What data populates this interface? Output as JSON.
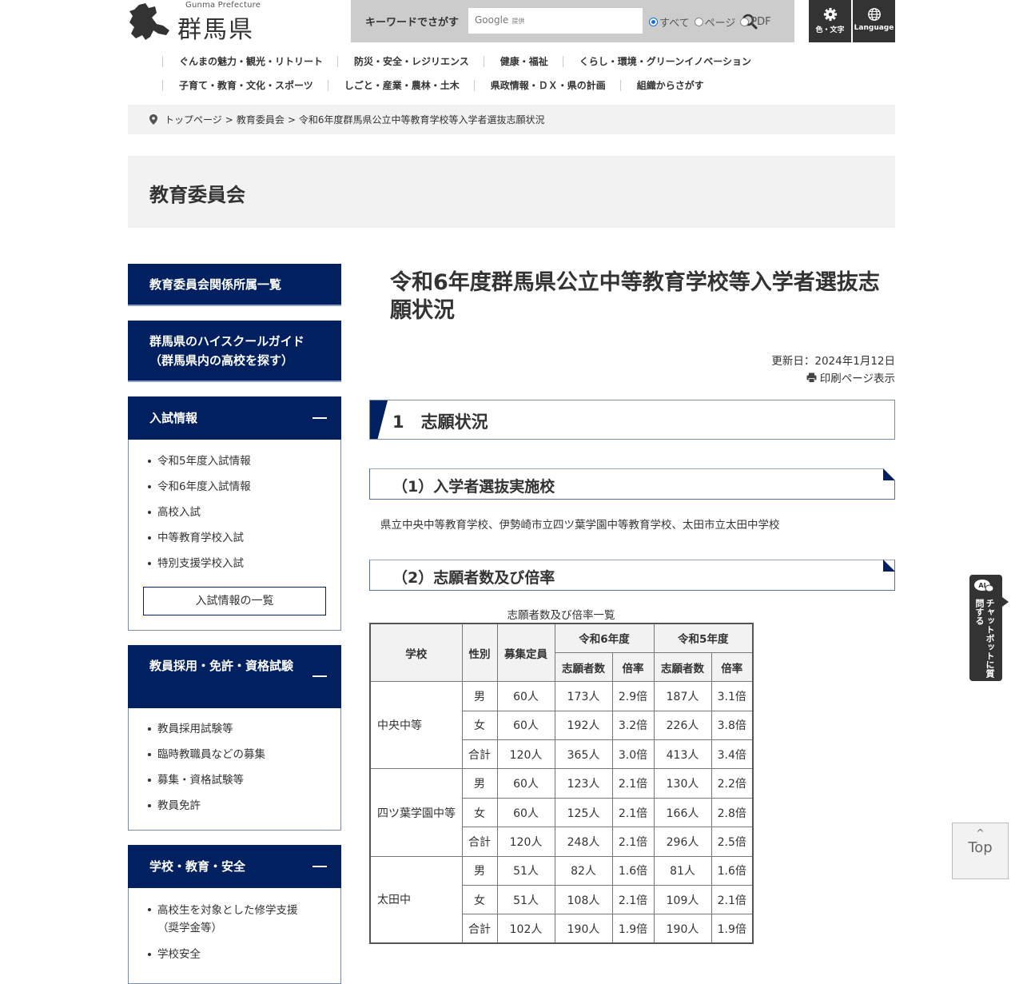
{
  "header": {
    "logo_en": "Gunma Prefecture",
    "logo_jp": "群馬県",
    "search": {
      "label": "キーワードでさがす",
      "placeholder": "Google",
      "placeholder_sub": "提供",
      "options": [
        {
          "label": "すべて",
          "selected": true
        },
        {
          "label": "ページ",
          "selected": false
        },
        {
          "label": "PDF",
          "selected": false
        }
      ]
    },
    "tools": [
      {
        "icon": "gear-icon",
        "label": "色・文字"
      },
      {
        "icon": "globe-icon",
        "label": "Language"
      }
    ]
  },
  "gnav": {
    "row1": [
      "ぐんまの魅力・観光・リトリート",
      "防災・安全・レジリエンス",
      "健康・福祉",
      "くらし・環境・グリーンイノベーション"
    ],
    "row2": [
      "子育て・教育・文化・スポーツ",
      "しごと・産業・農林・土木",
      "県政情報・ＤＸ・県の計画",
      "組織からさがす"
    ]
  },
  "breadcrumb": {
    "items": [
      "トップページ",
      "教育委員会",
      "令和6年度群馬県公立中等教育学校等入学者選抜志願状況"
    ],
    "separator": ">"
  },
  "department": "教育委員会",
  "sidebar": {
    "buttons": [
      "教育委員会関係所属一覧",
      "群馬県のハイスクールガイド（群馬県内の高校を探す）"
    ],
    "sections": [
      {
        "title": "入試情報",
        "items": [
          "令和5年度入試情報",
          "令和6年度入試情報",
          "高校入試",
          "中等教育学校入試",
          "特別支援学校入試"
        ],
        "more": "入試情報の一覧"
      },
      {
        "title": "教員採用・免許・資格試験",
        "items": [
          "教員採用試験等",
          "臨時教職員などの募集",
          "募集・資格試験等",
          "教員免許"
        ]
      },
      {
        "title": "学校・教育・安全",
        "items": [
          "高校生を対象とした修学支援（奨学金等）",
          "学校安全"
        ]
      }
    ]
  },
  "main": {
    "title": "令和6年度群馬県公立中等教育学校等入学者選抜志願状況",
    "updated": "更新日：2024年1月12日",
    "print": "印刷ページ表示",
    "h2": "1　志願状況",
    "h3_1": "（1）入学者選抜実施校",
    "schools_text": "県立中央中等教育学校、伊勢崎市立四ツ葉学園中等教育学校、太田市立太田中学校",
    "h3_2": "（2）志願者数及び倍率",
    "table": {
      "caption": "志願者数及び倍率一覧",
      "headers": {
        "school": "学校",
        "gender": "性別",
        "capacity": "募集定員",
        "r6": "令和6年度",
        "r5": "令和5年度",
        "applicants": "志願者数",
        "ratio": "倍率"
      },
      "groups": [
        {
          "school": "中央中等",
          "rows": [
            {
              "gender": "男",
              "capacity": "60人",
              "r6_app": "173人",
              "r6_ratio": "2.9倍",
              "r5_app": "187人",
              "r5_ratio": "3.1倍"
            },
            {
              "gender": "女",
              "capacity": "60人",
              "r6_app": "192人",
              "r6_ratio": "3.2倍",
              "r5_app": "226人",
              "r5_ratio": "3.8倍"
            },
            {
              "gender": "合計",
              "capacity": "120人",
              "r6_app": "365人",
              "r6_ratio": "3.0倍",
              "r5_app": "413人",
              "r5_ratio": "3.4倍"
            }
          ]
        },
        {
          "school": "四ツ葉学園中等",
          "rows": [
            {
              "gender": "男",
              "capacity": "60人",
              "r6_app": "123人",
              "r6_ratio": "2.1倍",
              "r5_app": "130人",
              "r5_ratio": "2.2倍"
            },
            {
              "gender": "女",
              "capacity": "60人",
              "r6_app": "125人",
              "r6_ratio": "2.1倍",
              "r5_app": "166人",
              "r5_ratio": "2.8倍"
            },
            {
              "gender": "合計",
              "capacity": "120人",
              "r6_app": "248人",
              "r6_ratio": "2.1倍",
              "r5_app": "296人",
              "r5_ratio": "2.5倍"
            }
          ]
        },
        {
          "school": "太田中",
          "rows": [
            {
              "gender": "男",
              "capacity": "51人",
              "r6_app": "82人",
              "r6_ratio": "1.6倍",
              "r5_app": "81人",
              "r5_ratio": "1.6倍"
            },
            {
              "gender": "女",
              "capacity": "51人",
              "r6_app": "108人",
              "r6_ratio": "2.1倍",
              "r5_app": "109人",
              "r5_ratio": "2.1倍"
            },
            {
              "gender": "合計",
              "capacity": "102人",
              "r6_app": "190人",
              "r6_ratio": "1.9倍",
              "r5_app": "190人",
              "r5_ratio": "1.9倍"
            }
          ]
        }
      ]
    }
  },
  "floating": {
    "chat_badge": "AI",
    "chat_label": "チャットボットに質問する",
    "top_caret": "^",
    "top_label": "Top"
  },
  "colors": {
    "navy": "#002060",
    "gray_bg": "#f2f2f2",
    "search_bg": "#cccccc",
    "tool_bg": "#333333"
  }
}
